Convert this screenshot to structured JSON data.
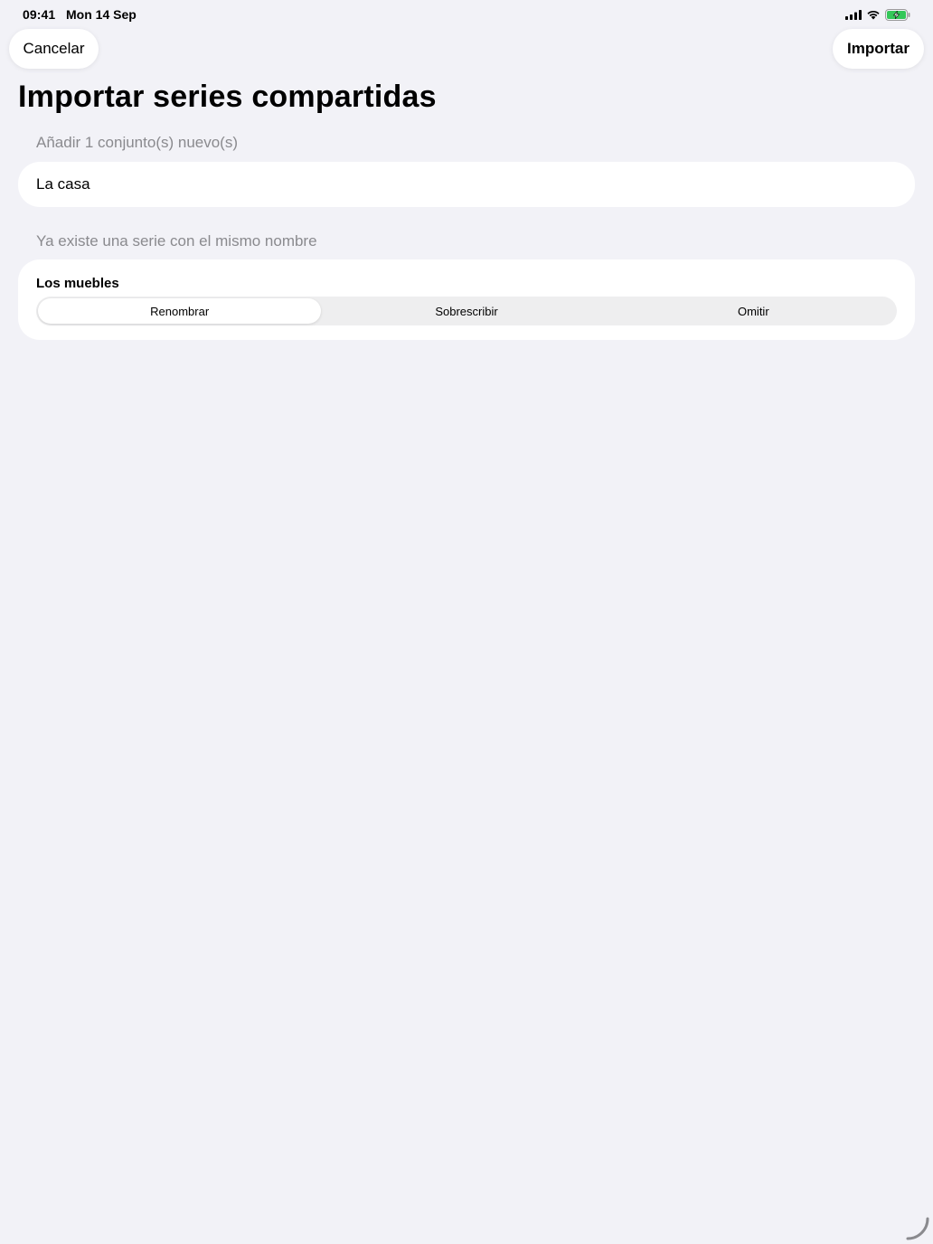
{
  "status_bar": {
    "time": "09:41",
    "date": "Mon 14 Sep",
    "icons": [
      "cellular-signal-icon",
      "wifi-icon",
      "battery-charging-icon"
    ],
    "battery_color": "#34c759"
  },
  "toolbar": {
    "cancel_label": "Cancelar",
    "import_label": "Importar"
  },
  "page": {
    "title": "Importar series compartidas"
  },
  "new_sets": {
    "header": "Añadir 1 conjunto(s) nuevo(s)",
    "items": [
      "La casa"
    ]
  },
  "conflicts": {
    "header": "Ya existe una serie con el mismo nombre",
    "items": [
      {
        "name": "Los muebles",
        "options": [
          "Renombrar",
          "Sobrescribir",
          "Omitir"
        ],
        "selected": "Renombrar"
      }
    ]
  },
  "colors": {
    "background": "#f2f2f7",
    "card": "#ffffff",
    "secondary_text": "#8a8a8e",
    "segment_track": "#eeeeef"
  }
}
